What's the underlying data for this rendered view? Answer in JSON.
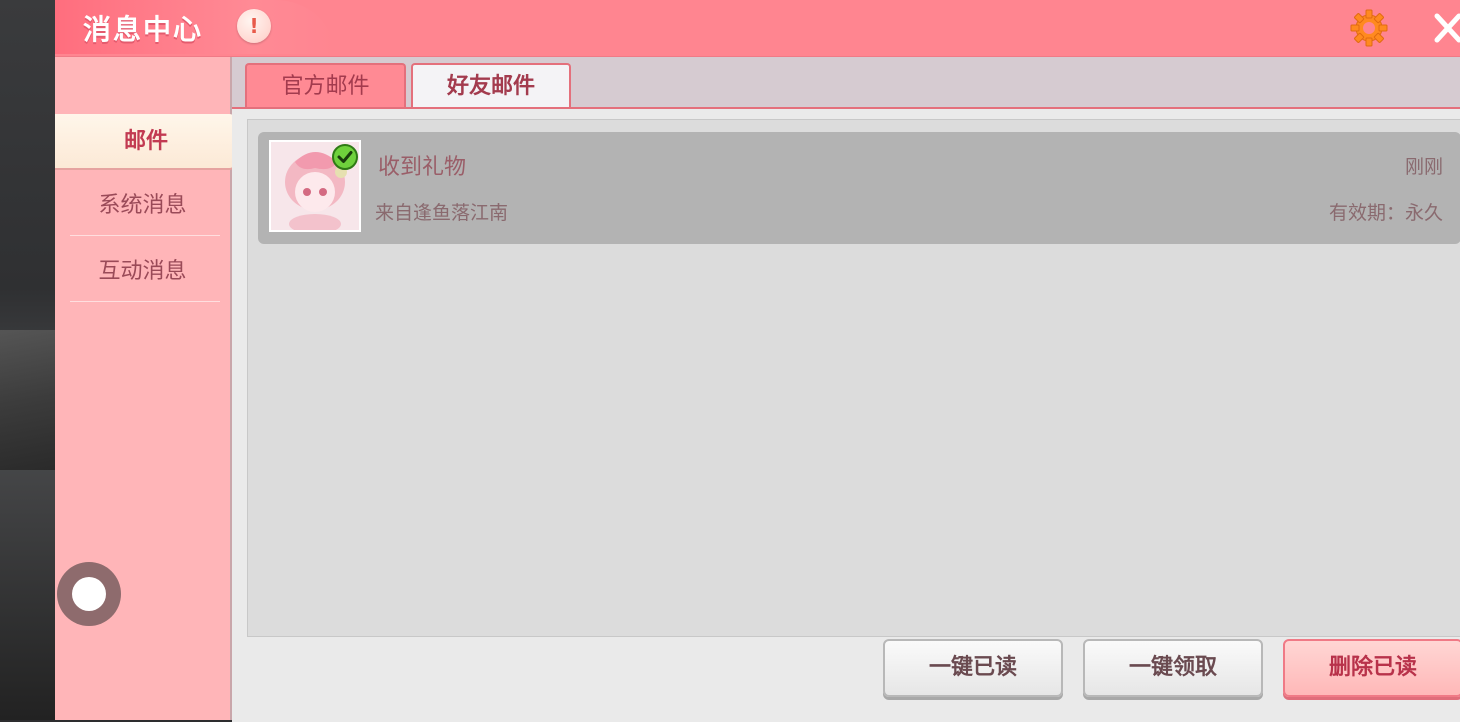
{
  "header": {
    "title": "消息中心",
    "alert_glyph": "!",
    "settings_icon": "gear-icon",
    "close_icon": "close-icon"
  },
  "sidebar": {
    "items": [
      {
        "label": "邮件",
        "active": true
      },
      {
        "label": "系统消息",
        "active": false
      },
      {
        "label": "互动消息",
        "active": false
      }
    ]
  },
  "tabs": [
    {
      "label": "官方邮件",
      "active": false
    },
    {
      "label": "好友邮件",
      "active": true
    }
  ],
  "mails": [
    {
      "title": "收到礼物",
      "from": "来自逢鱼落江南",
      "time": "刚刚",
      "expiry": "有效期：永久",
      "read": true
    }
  ],
  "actions": {
    "mark_all_read": "一键已读",
    "claim_all": "一键领取",
    "delete_read": "删除已读"
  },
  "colors": {
    "header": "#ff8590",
    "sidebar": "#ffb5b8",
    "accent": "#e4707c",
    "mail_row": "#b3b3b3"
  }
}
